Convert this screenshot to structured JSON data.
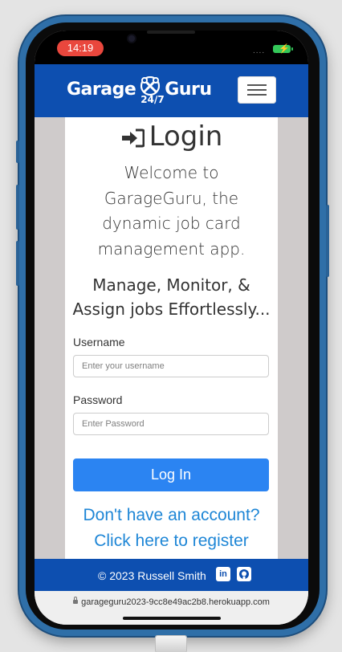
{
  "status_bar": {
    "time": "14:19",
    "signal": "....",
    "battery_icon": "charging-battery-icon"
  },
  "navbar": {
    "brand_left": "Garage",
    "brand_right": "Guru",
    "brand_tag": "24/7",
    "menu_icon": "hamburger-menu-icon"
  },
  "login": {
    "title": "Login",
    "title_icon": "sign-in-icon",
    "welcome_lines": [
      "Welcome to",
      "GarageGuru, the",
      "dynamic job card",
      "management app."
    ],
    "tagline_lines": [
      "Manage, Monitor, &",
      "Assign jobs Effortlessly..."
    ],
    "username_label": "Username",
    "username_placeholder": "Enter your username",
    "password_label": "Password",
    "password_placeholder": "Enter Password",
    "submit_label": "Log In",
    "register_line1": "Don't have an account?",
    "register_line2": "Click here to register"
  },
  "footer": {
    "copyright": "© 2023 Russell Smith",
    "linkedin_icon": "linkedin-icon",
    "linkedin_text": "in",
    "github_icon": "github-icon"
  },
  "browser": {
    "url": "garageguru2023-9cc8e49ac2b8.herokuapp.com"
  },
  "colors": {
    "brand_blue": "#0d4fb0",
    "button_blue": "#2b84f2",
    "link_blue": "#1e86d6",
    "time_pill": "#e9473d",
    "battery": "#34c759"
  }
}
